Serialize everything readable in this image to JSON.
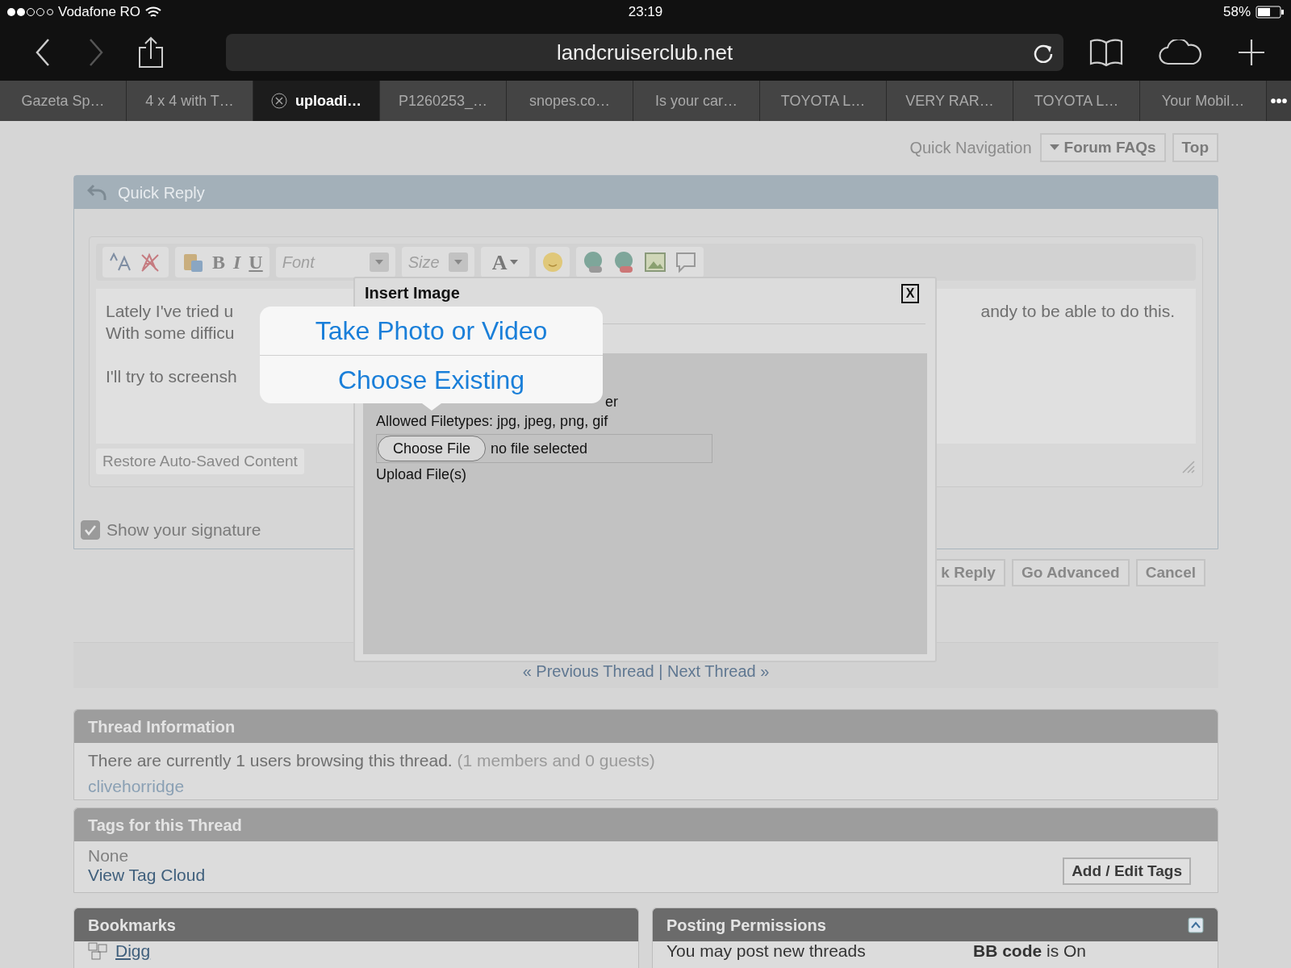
{
  "status_bar": {
    "carrier": "Vodafone RO",
    "time": "23:19",
    "battery": "58%"
  },
  "browser": {
    "url": "landcruiserclub.net"
  },
  "tabs": [
    {
      "label": "Gazeta Sp…",
      "selected": false
    },
    {
      "label": "4 x 4 with T…",
      "selected": false
    },
    {
      "label": "uploadi…",
      "selected": true
    },
    {
      "label": "P1260253_…",
      "selected": false
    },
    {
      "label": "snopes.co…",
      "selected": false
    },
    {
      "label": "Is your car…",
      "selected": false
    },
    {
      "label": "TOYOTA L…",
      "selected": false
    },
    {
      "label": "VERY RAR…",
      "selected": false
    },
    {
      "label": "TOYOTA L…",
      "selected": false
    },
    {
      "label": "Your Mobil…",
      "selected": false
    }
  ],
  "more_tabs": "•••",
  "page": {
    "quick_navigation": "Quick Navigation",
    "nav_buttons": [
      "Forum FAQs",
      "Top"
    ],
    "quick_reply": {
      "title": "Quick Reply",
      "toolbar": {
        "font": "Font",
        "size": "Size",
        "bold": "B",
        "italic": "I",
        "underline": "U",
        "text_color_button": "A"
      },
      "message_lines": [
        {
          "left": "Lately I've tried u",
          "right": "andy to be able to do this."
        },
        {
          "left": "With some difficu"
        },
        {
          "left": "I'll try to screensh"
        }
      ],
      "restore_button": "Restore Auto-Saved Content",
      "signature": {
        "label": "Show your signature",
        "checked": true
      }
    },
    "actions": [
      "k Reply",
      "Go Advanced",
      "Cancel"
    ],
    "thread_nav": "« Previous Thread | Next Thread »",
    "thread_information": {
      "title": "Thread Information",
      "text": "There are currently 1 users browsing this thread.",
      "counts": "(1 members and 0 guests)",
      "users": [
        "clivehorridge"
      ]
    },
    "tags": {
      "title": "Tags for this Thread",
      "text": "None",
      "link": "View Tag Cloud",
      "button": "Add / Edit Tags"
    },
    "bookmarks": {
      "title": "Bookmarks",
      "items": [
        "Digg"
      ]
    },
    "posting_permissions": {
      "title": "Posting Permissions",
      "text": "You may post new threads",
      "bb_code": "**BB code** is On"
    }
  },
  "dialog": {
    "title": "Insert Image",
    "close": "X",
    "intro": "er",
    "filetypes": "Allowed Filetypes: jpg, jpeg, png, gif",
    "choose_button": "Choose File",
    "file_status": "no file selected",
    "upload": "Upload File(s)"
  },
  "popover": {
    "options": [
      "Take Photo or Video",
      "Choose Existing"
    ]
  }
}
